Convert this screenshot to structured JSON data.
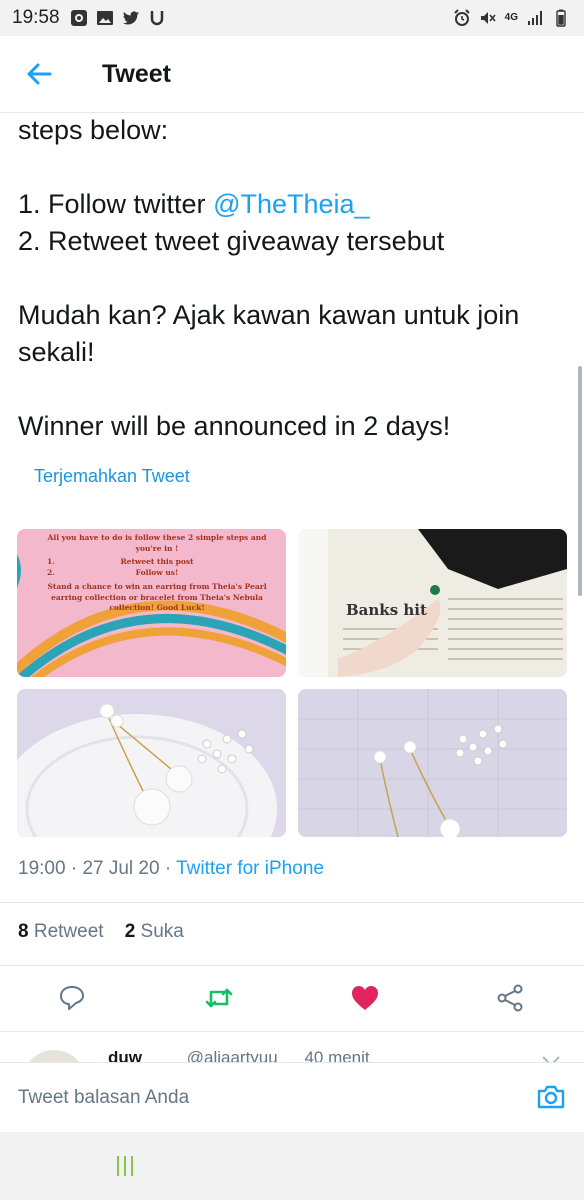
{
  "status_bar": {
    "time": "19:58",
    "left_icons": [
      "screen-record-icon",
      "gallery-icon",
      "twitter-bird-icon",
      "u-icon"
    ],
    "right_icons": [
      "alarm-icon",
      "mute-icon",
      "network-4g-icon",
      "signal-icon",
      "battery-icon"
    ],
    "network": "4G"
  },
  "header": {
    "title": "Tweet",
    "accent": "#1da1f2"
  },
  "tweet": {
    "line_1": "steps below:",
    "line_2_prefix": "1. Follow twitter ",
    "line_2_mention": "@TheTheia_",
    "line_3": "2. Retweet tweet giveaway tersebut",
    "line_4": "Mudah kan? Ajak kawan kawan untuk join sekali!",
    "line_5": "Winner will be announced in 2 days!",
    "translate_label": "Terjemahkan Tweet",
    "media": {
      "poster_line_1": "All you have to do is follow these 2 simple steps and you're in !",
      "poster_item_1_num": "1.",
      "poster_item_1": "Retweet this post",
      "poster_item_2_num": "2.",
      "poster_item_2": "Follow us!",
      "poster_line_2": "Stand a chance to win an earring from Theia's Pearl earring collection or bracelet from Theia's Nebula collection! Good Luck!",
      "newspaper_headline": "Banks hit"
    },
    "time": "19:00",
    "date": "27 Jul 20",
    "source": "Twitter for iPhone",
    "retweet_count": "8",
    "retweet_label": "Retweet",
    "like_count": "2",
    "like_label": "Suka"
  },
  "actions": {
    "reply_icon": "reply-icon",
    "retweet_icon": "retweet-icon",
    "like_icon": "heart-icon",
    "share_icon": "share-icon",
    "retweet_color": "#17bf63",
    "like_color": "#e0245e"
  },
  "reply_preview": {
    "name": "duw",
    "handle": "@aliaartyuu",
    "time": "40 menit"
  },
  "composer": {
    "placeholder": "Tweet balasan Anda"
  }
}
